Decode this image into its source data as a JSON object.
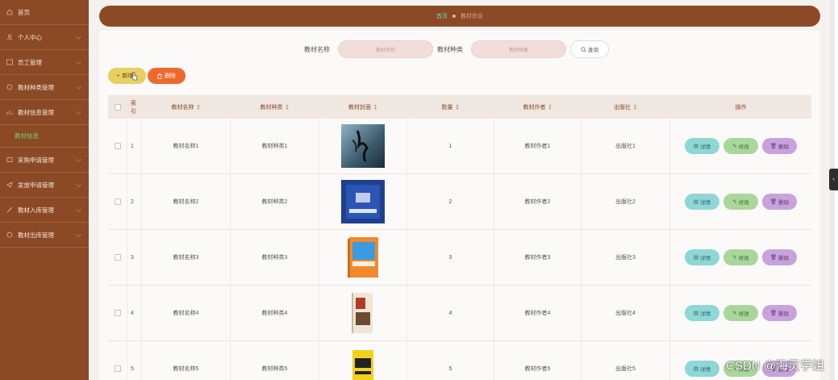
{
  "sidebar": {
    "items": [
      {
        "label": "首页",
        "icon": "home-icon"
      },
      {
        "label": "个人中心",
        "icon": "user-icon"
      },
      {
        "label": "员工管理",
        "icon": "grid-icon"
      },
      {
        "label": "教材种类管理",
        "icon": "list-icon"
      },
      {
        "label": "教材信息管理",
        "icon": "chart-icon"
      },
      {
        "label": "采购申请管理",
        "icon": "cart-icon"
      },
      {
        "label": "发放申请管理",
        "icon": "send-icon"
      },
      {
        "label": "教材入库管理",
        "icon": "box-icon"
      },
      {
        "label": "教材出库管理",
        "icon": "out-icon"
      }
    ],
    "active_sub": "教材信息"
  },
  "breadcrumb": {
    "home": "首页",
    "current": "教材信息"
  },
  "search": {
    "name_label": "教材名称",
    "name_placeholder": "教材名称",
    "type_label": "教材种类",
    "type_placeholder": "教材种类",
    "button": "查询"
  },
  "actions": {
    "add": "新增",
    "delete": "删除"
  },
  "table": {
    "headers": {
      "index": "索引",
      "name": "教材名称",
      "type": "教材种类",
      "cover": "教材封面",
      "quantity": "数量",
      "author": "教材作者",
      "publisher": "出版社",
      "ops": "操作"
    },
    "ops": {
      "detail": "详情",
      "edit": "修改",
      "delete": "删除"
    },
    "rows": [
      {
        "index": "1",
        "name": "教材名称1",
        "type": "教材种类1",
        "quantity": "1",
        "author": "教材作者1",
        "publisher": "出版社1"
      },
      {
        "index": "2",
        "name": "教材名称2",
        "type": "教材种类2",
        "quantity": "2",
        "author": "教材作者2",
        "publisher": "出版社2"
      },
      {
        "index": "3",
        "name": "教材名称3",
        "type": "教材种类3",
        "quantity": "3",
        "author": "教材作者3",
        "publisher": "出版社3"
      },
      {
        "index": "4",
        "name": "教材名称4",
        "type": "教材种类4",
        "quantity": "4",
        "author": "教材作者4",
        "publisher": "出版社4"
      },
      {
        "index": "5",
        "name": "教材名称5",
        "type": "教材种类5",
        "quantity": "5",
        "author": "教材作者5",
        "publisher": "出版社5"
      }
    ]
  },
  "watermark": "CSDN @海灵学姐",
  "colors": {
    "sidebar": "#8b4a25",
    "accent_green": "#6fd36f",
    "add_button": "#e8cf61",
    "delete_button": "#f0692a"
  }
}
